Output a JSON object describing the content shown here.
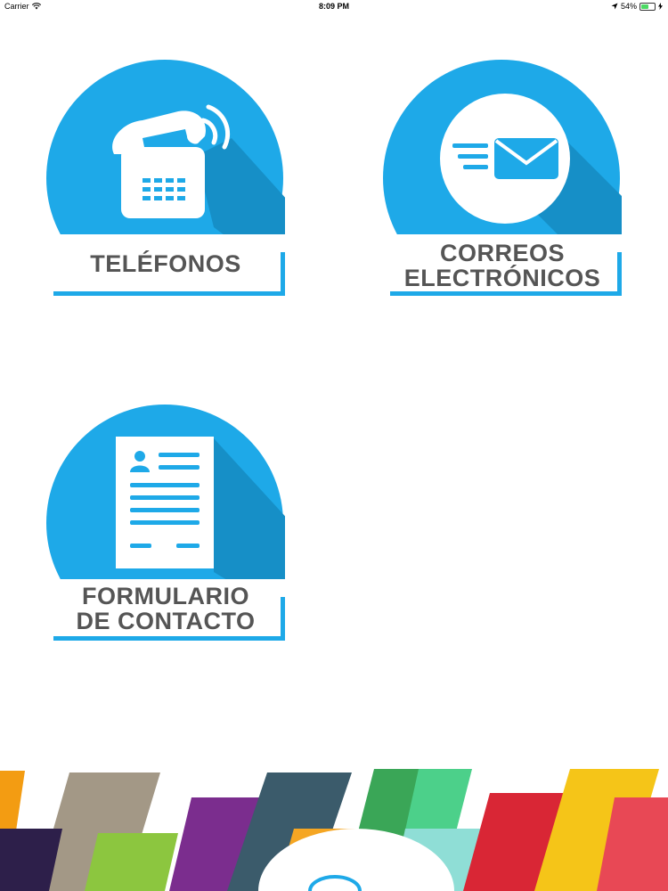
{
  "status_bar": {
    "carrier": "Carrier",
    "time": "8:09 PM",
    "battery_percent": "54%",
    "battery_level": 0.54
  },
  "tiles": [
    {
      "label_lines": [
        "TELÉFONOS"
      ],
      "icon": "telephone-icon"
    },
    {
      "label_lines": [
        "CORREOS",
        "ELECTRÓNICOS"
      ],
      "icon": "envelope-icon"
    },
    {
      "label_lines": [
        "FORMULARIO",
        "DE CONTACTO"
      ],
      "icon": "form-document-icon"
    }
  ],
  "colors": {
    "accent_blue": "#1ea9e8",
    "shadow_blue": "#168fc7",
    "label_gray": "#555555"
  }
}
